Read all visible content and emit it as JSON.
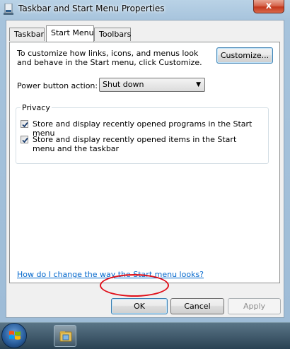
{
  "window": {
    "title": "Taskbar and Start Menu Properties",
    "close_glyph": "x"
  },
  "tabs": [
    {
      "label": "Taskbar",
      "active": false
    },
    {
      "label": "Start Menu",
      "active": true
    },
    {
      "label": "Toolbars",
      "active": false
    }
  ],
  "start_menu": {
    "description": "To customize how links, icons, and menus look and behave in the Start menu, click Customize.",
    "customize_label": "Customize...",
    "power_label": "Power button action:",
    "power_value": "Shut down",
    "privacy_title": "Privacy",
    "privacy_options": [
      {
        "label": "Store and display recently opened programs in the Start menu",
        "checked": true
      },
      {
        "label": "Store and display recently opened items in the Start menu and the taskbar",
        "checked": true
      }
    ],
    "help_link": "How do I change the way the Start menu looks?"
  },
  "buttons": {
    "ok": "OK",
    "cancel": "Cancel",
    "apply": "Apply"
  },
  "icons": {
    "window_icon": "taskbar-icon",
    "start": "windows-logo-icon",
    "taskbar_app": "explorer-folder-icon"
  },
  "colors": {
    "highlight_circle": "#e0101a",
    "link": "#0066cc"
  }
}
